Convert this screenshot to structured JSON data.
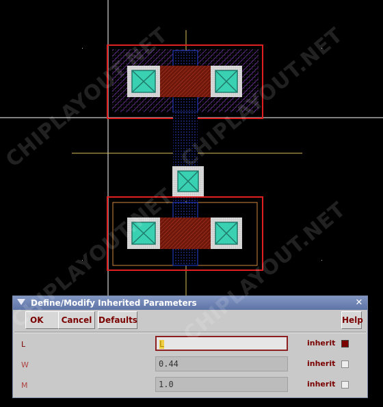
{
  "layout_view": {
    "watermark": "CHIPLAYOUT.NET",
    "colors": {
      "background": "#000000",
      "diffusion_box": "#e02020",
      "poly": "#1d35b8",
      "contact_fill": "#3ad1b3",
      "gate_overlap": "#8a1c10",
      "crosshair": "#ffffff",
      "axis": "#e0c060",
      "nwell_outline": "#d08a40"
    }
  },
  "dialog": {
    "title": "Define/Modify Inherited Parameters",
    "buttons": {
      "ok": "OK",
      "cancel": "Cancel",
      "defaults": "Defaults",
      "help": "Help"
    },
    "params": [
      {
        "label": "L",
        "value": "L",
        "inherit_label": "inherit",
        "inherit_checked": true,
        "enabled": true
      },
      {
        "label": "W",
        "value": "0.44",
        "inherit_label": "inherit",
        "inherit_checked": false,
        "enabled": false
      },
      {
        "label": "M",
        "value": "1.0",
        "inherit_label": "inherit",
        "inherit_checked": false,
        "enabled": false
      }
    ]
  }
}
